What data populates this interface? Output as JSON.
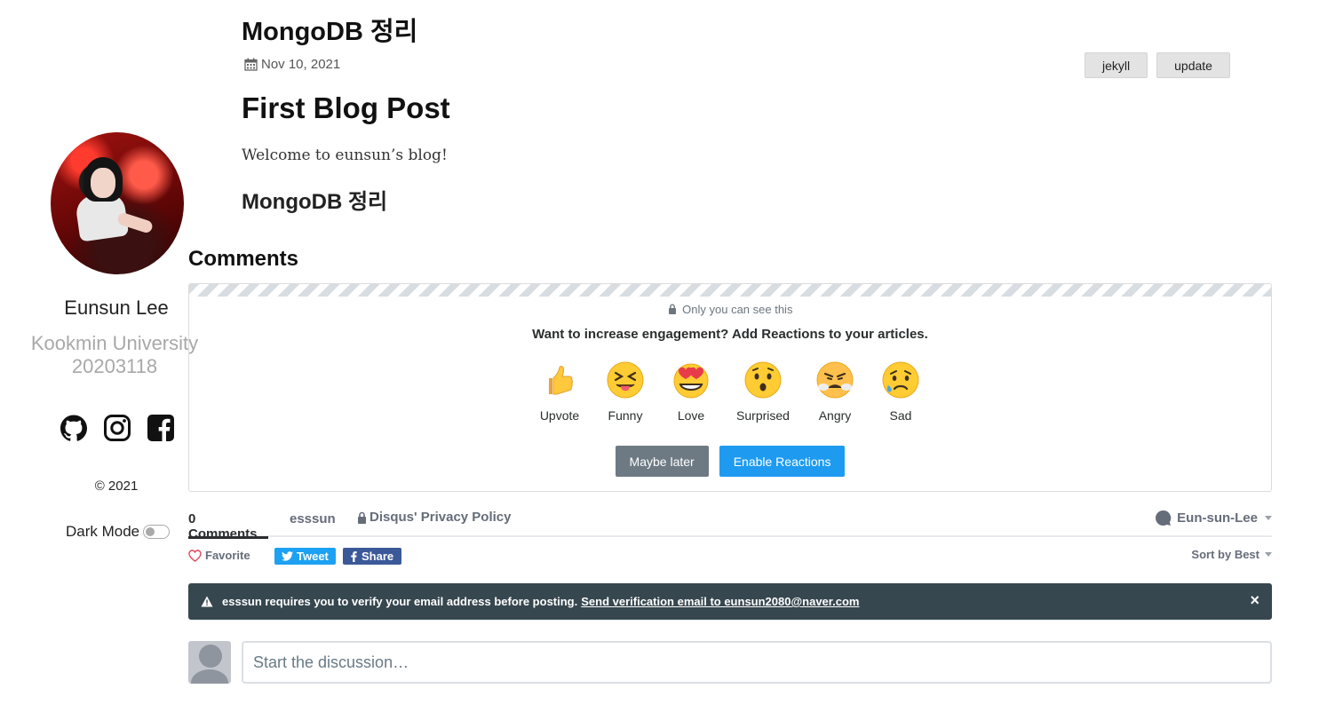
{
  "sidebar": {
    "name": "Eunsun Lee",
    "university": "Kookmin University",
    "student_id": "20203118",
    "social_icons": [
      "github-icon",
      "instagram-icon",
      "facebook-icon"
    ],
    "copyright": "© 2021",
    "dark_mode_label": "Dark Mode",
    "dark_mode_on": false
  },
  "post": {
    "title": "MongoDB 정리",
    "date": "Nov 10, 2021",
    "tags": [
      "jekyll",
      "update"
    ],
    "heading1": "First Blog Post",
    "body": "Welcome to eunsun’s blog!",
    "heading2": "MongoDB 정리"
  },
  "comments": {
    "heading": "Comments",
    "reactions_panel": {
      "visibility_note": "Only you can see this",
      "prompt": "Want to increase engagement? Add Reactions to your articles.",
      "reactions": [
        "Upvote",
        "Funny",
        "Love",
        "Surprised",
        "Angry",
        "Sad"
      ],
      "maybe_later": "Maybe later",
      "enable": "Enable Reactions"
    },
    "nav": {
      "count": "0 Comments",
      "site": "esssun",
      "privacy": "Disqus' Privacy Policy",
      "user": "Eun-sun-Lee"
    },
    "actions": {
      "favorite": "Favorite",
      "tweet": "Tweet",
      "share": "Share",
      "sort": "Sort by Best"
    },
    "alert": {
      "message": "esssun requires you to verify your email address before posting.",
      "link": "Send verification email to eunsun2080@naver.com",
      "close": "×"
    },
    "composer_placeholder": "Start the discussion…"
  },
  "colors": {
    "tweet": "#1da1f2",
    "facebook": "#3b5998",
    "enable_button": "#1e9bf0",
    "maybe_button": "#6d7a83",
    "alert_bg": "#37474f"
  }
}
